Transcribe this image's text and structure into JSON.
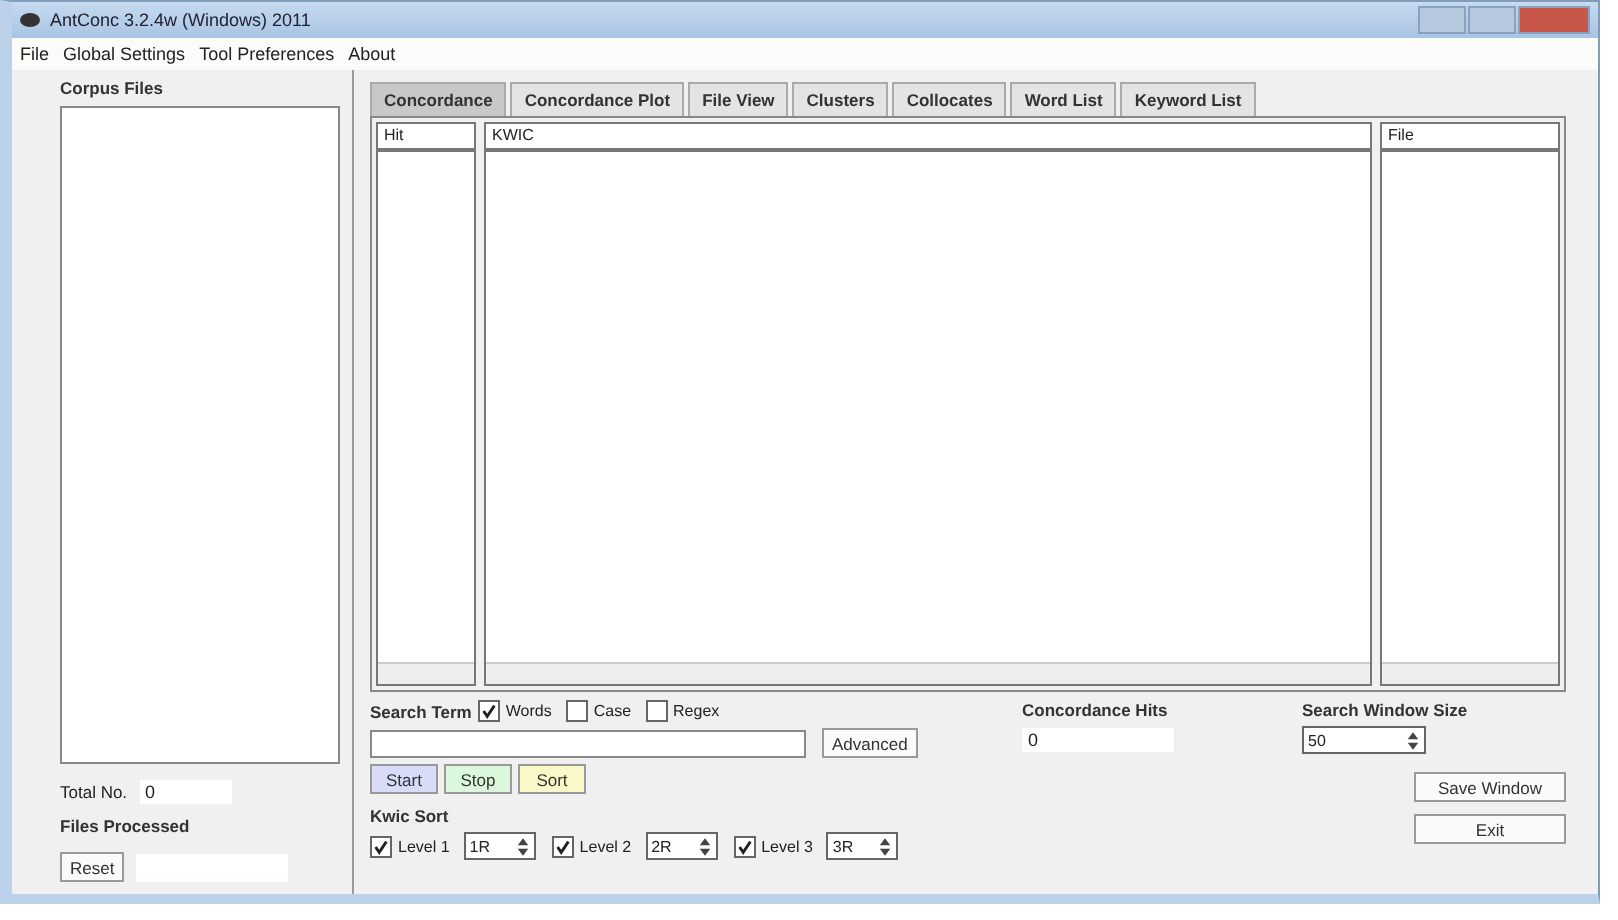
{
  "window": {
    "title": "AntConc 3.2.4w (Windows) 2011"
  },
  "menu": [
    "File",
    "Global Settings",
    "Tool Preferences",
    "About"
  ],
  "corpus": {
    "label": "Corpus Files",
    "total_label": "Total No.",
    "total": "0",
    "processed_label": "Files Processed",
    "reset": "Reset"
  },
  "tabs": [
    {
      "label": "Concordance",
      "selected": true
    },
    {
      "label": "Concordance Plot",
      "selected": false
    },
    {
      "label": "File View",
      "selected": false
    },
    {
      "label": "Clusters",
      "selected": false
    },
    {
      "label": "Collocates",
      "selected": false
    },
    {
      "label": "Word List",
      "selected": false
    },
    {
      "label": "Keyword List",
      "selected": false
    }
  ],
  "columns": [
    "Hit",
    "KWIC",
    "File"
  ],
  "search": {
    "label": "Search Term",
    "options": [
      {
        "label": "Words",
        "checked": true
      },
      {
        "label": "Case",
        "checked": false
      },
      {
        "label": "Regex",
        "checked": false
      }
    ],
    "advanced": "Advanced"
  },
  "hits": {
    "label": "Concordance Hits",
    "value": "0"
  },
  "window_size": {
    "label": "Search Window Size",
    "value": "50"
  },
  "actions": [
    {
      "label": "Start",
      "color": "#d8dcf8"
    },
    {
      "label": "Stop",
      "color": "#dcf8dc"
    },
    {
      "label": "Sort",
      "color": "#f8f8c8"
    }
  ],
  "kwic_sort": {
    "label": "Kwic Sort",
    "levels": [
      {
        "label": "Level 1",
        "checked": true,
        "value": "1R"
      },
      {
        "label": "Level 2",
        "checked": true,
        "value": "2R"
      },
      {
        "label": "Level 3",
        "checked": true,
        "value": "3R"
      }
    ]
  },
  "side_buttons": [
    "Save Window",
    "Exit"
  ]
}
